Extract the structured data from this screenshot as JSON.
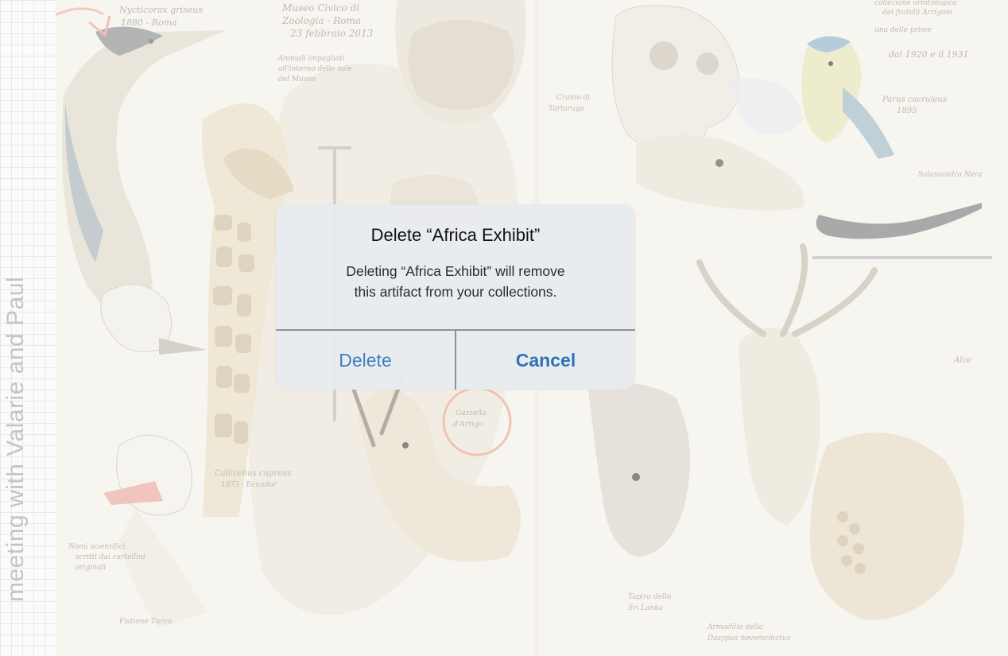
{
  "sidebar": {
    "vertical_label": "meeting with Valarie and Paul"
  },
  "background": {
    "notes": {
      "top_left": [
        "Nycticorax griseus",
        "1880 - Roma"
      ],
      "museum": [
        "Museo Civico di",
        "Zoologia - Roma",
        "23 febbraio 2013"
      ],
      "museum_sub": [
        "Animali impagliati",
        "all'interno delle sale",
        "del Museo"
      ],
      "right_top": [
        "collezione ornitologica",
        "dei fratelli Arrigoni",
        "una delle prime",
        "dal 1920 e il 1931"
      ],
      "parus": [
        "Parus caeruleus",
        "1895"
      ],
      "cranio": [
        "Cranio di",
        "Tartaruga"
      ],
      "salamandra": "Salamandra Nera",
      "alce": "Alce",
      "circled": [
        "Gazzella",
        "d'Arrigo"
      ],
      "callicebus": [
        "Callicebus cupreus",
        "1873 - Ecuador"
      ],
      "note_left": [
        "Nomi scientifici",
        "scritti dai cartellini",
        "originali"
      ],
      "fistione": "Fistione Turco",
      "tapiro": [
        "Tapiro dello",
        "Sri Lanka"
      ],
      "armadillo": [
        "Armadillo della",
        "Dasypus novemcinctus"
      ]
    }
  },
  "alert": {
    "title": "Delete “Africa Exhibit”",
    "message_line1": "Deleting “Africa Exhibit” will remove",
    "message_line2": "this artifact from your collections.",
    "delete_label": "Delete",
    "cancel_label": "Cancel"
  },
  "colors": {
    "accent_link": "#3f7fc0",
    "accent_orange": "#e9a48a",
    "alert_bg": "#e8ebee"
  }
}
